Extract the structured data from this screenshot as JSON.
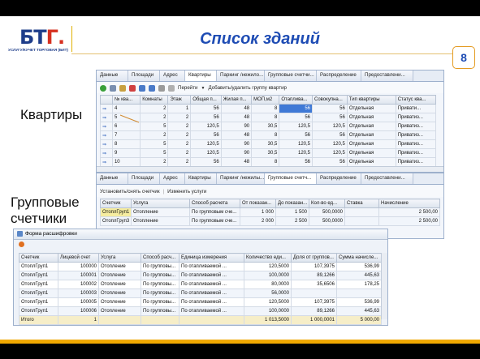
{
  "slide": {
    "logo_text_a": "БТ",
    "logo_text_b": "Г.",
    "logo_subtitle": "УСЛУГУ/КУЧЕТ ТОРГОВАЯ (БИТ)",
    "title": "Список зданий",
    "page_number": "8",
    "label_apartments": "Квартиры",
    "label_group_meters_1": "Групповые",
    "label_group_meters_2": "счетчики"
  },
  "apartments_window": {
    "tabs": [
      "Данные",
      "Площади",
      "Адрес",
      "Квартиры",
      "Паркинг /нежило...",
      "Групповые счетчи...",
      "Распределение",
      "Предоставлени..."
    ],
    "active_tab": 3,
    "toolbar": {
      "goto_label": "Перейти",
      "add_remove_label": "Добавить/удалить группу квартир"
    },
    "columns": [
      "№ ква...",
      "Комнаты",
      "Этаж",
      "Общая п...",
      "Жилая п...",
      "МОП,м2",
      "Отаплива...",
      "Совокупна...",
      "Тип квартиры",
      "Статус ква..."
    ],
    "rows": [
      [
        "4",
        "2",
        "1",
        "56",
        "48",
        "8",
        "56",
        "56",
        "Отдельная",
        "Привати..."
      ],
      [
        "5",
        "2",
        "2",
        "56",
        "48",
        "8",
        "56",
        "56",
        "Отдельная",
        "Приватиз..."
      ],
      [
        "6",
        "5",
        "2",
        "120,5",
        "90",
        "30,5",
        "120,5",
        "120,5",
        "Отдельная",
        "Приватиз..."
      ],
      [
        "7",
        "2",
        "2",
        "56",
        "48",
        "8",
        "56",
        "56",
        "Отдельная",
        "Приватиз..."
      ],
      [
        "8",
        "5",
        "2",
        "120,5",
        "90",
        "30,5",
        "120,5",
        "120,5",
        "Отдельная",
        "Приватиз..."
      ],
      [
        "9",
        "5",
        "2",
        "120,5",
        "90",
        "30,5",
        "120,5",
        "120,5",
        "Отдельная",
        "Приватиз..."
      ],
      [
        "10",
        "2",
        "2",
        "56",
        "48",
        "8",
        "56",
        "56",
        "Отдельная",
        "Приватиз..."
      ]
    ]
  },
  "meters_window": {
    "tabs": [
      "Данные",
      "Площади",
      "Адрес",
      "Квартиры",
      "Паркинг /нежилы...",
      "Групповые счетч...",
      "Распределение",
      "Предоставлени..."
    ],
    "active_tab": 5,
    "toolbar": {
      "set_label": "Установить/снять счетчик",
      "change_label": "Изменить услуги"
    },
    "columns": [
      "Счетчик",
      "Услуга",
      "Способ расчета",
      "От показан...",
      "До показан...",
      "Кол-во ед...",
      "Ставка",
      "Начисление"
    ],
    "rows": [
      [
        "ОтоплГруп1",
        "Отопление",
        "По групповым сче...",
        "1 000",
        "1 500",
        "500,0000",
        "",
        "2 500,00"
      ],
      [
        "ОтоплГруп3",
        "Отопление",
        "По групповым сче...",
        "2 000",
        "2 500",
        "500,0000",
        "",
        "2 500,00"
      ]
    ]
  },
  "print_window": {
    "title": "Форма расшифровки",
    "columns": [
      "Счетчик",
      "Лицевой счет",
      "Услуга",
      "Способ расч...",
      "Единица измерения",
      "Количество еди...",
      "Доля от группов...",
      "Сумма начисле..."
    ],
    "rows": [
      [
        "ОтоплГруп1",
        "100000",
        "Отопление",
        "По групповы...",
        "По отапливаемой ...",
        "120,5000",
        "107,3975",
        "536,99"
      ],
      [
        "ОтоплГруп1",
        "100001",
        "Отопление",
        "По групповы...",
        "По отапливаемой ...",
        "100,0000",
        "89,1266",
        "445,63"
      ],
      [
        "ОтоплГруп1",
        "100002",
        "Отопление",
        "По групповы...",
        "По отапливаемой ...",
        "80,0000",
        "35,6506",
        "178,25"
      ],
      [
        "ОтоплГруп1",
        "100003",
        "Отопление",
        "По групповы...",
        "По отапливаемой ...",
        "56,0000",
        "",
        ""
      ],
      [
        "ОтоплГруп1",
        "100005",
        "Отопление",
        "По групповы...",
        "По отапливаемой ...",
        "120,5000",
        "107,3975",
        "536,99"
      ],
      [
        "ОтоплГруп1",
        "100006",
        "Отопление",
        "По групповы...",
        "По отапливаемой ...",
        "100,0000",
        "89,1266",
        "445,63"
      ]
    ],
    "total": {
      "label": "Итого",
      "count": "1",
      "quantity": "1 013,5000",
      "share": "1 000,0001",
      "sum": "5 000,00"
    }
  }
}
